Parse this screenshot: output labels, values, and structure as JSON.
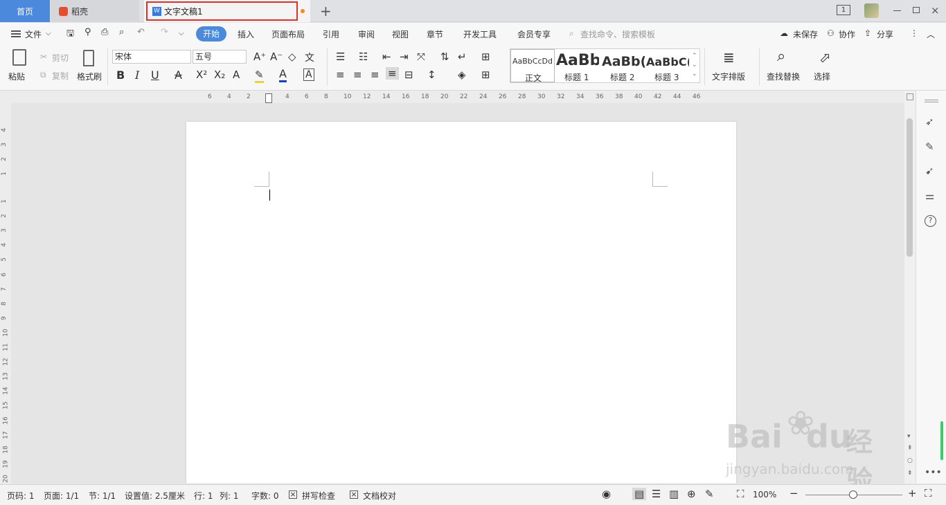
{
  "tabs": {
    "home": "首页",
    "daoke": "稻壳",
    "document": "文字文稿1"
  },
  "menubar": {
    "file": "文件",
    "items": [
      "开始",
      "插入",
      "页面布局",
      "引用",
      "审阅",
      "视图",
      "章节",
      "开发工具",
      "会员专享"
    ],
    "search_placeholder": "查找命令、搜索模板",
    "unsaved": "未保存",
    "collaborate": "协作",
    "share": "分享"
  },
  "ribbon": {
    "paste": "粘贴",
    "cut": "剪切",
    "copy": "复制",
    "format_painter": "格式刷",
    "font_name": "宋体",
    "font_size": "五号",
    "styles": [
      {
        "preview": "AaBbCcDd",
        "label": "正文"
      },
      {
        "preview": "AaBb",
        "label": "标题 1"
      },
      {
        "preview": "AaBb(",
        "label": "标题 2"
      },
      {
        "preview": "AaBbC(",
        "label": "标题 3"
      }
    ],
    "text_layout": "文字排版",
    "find_replace": "查找替换",
    "select": "选择"
  },
  "ruler": {
    "h": [
      "6",
      "4",
      "2",
      "2",
      "4",
      "6",
      "8",
      "10",
      "12",
      "14",
      "16",
      "18",
      "20",
      "22",
      "24",
      "26",
      "28",
      "30",
      "32",
      "34",
      "36",
      "38",
      "40",
      "42",
      "44",
      "46"
    ],
    "v": [
      "4",
      "3",
      "2",
      "1",
      "1",
      "2",
      "3",
      "4",
      "5",
      "6",
      "7",
      "8",
      "9",
      "10",
      "11",
      "12",
      "13",
      "14",
      "15",
      "16",
      "17",
      "18",
      "19",
      "20"
    ]
  },
  "status": {
    "page_code": "页码: 1",
    "pages": "页面: 1/1",
    "section": "节: 1/1",
    "setting": "设置值: 2.5厘米",
    "row": "行: 1",
    "col": "列: 1",
    "word_count": "字数: 0",
    "spell_check": "拼写检查",
    "doc_proof": "文档校对",
    "zoom": "100%"
  },
  "watermark": {
    "brand": "Bai",
    "brand2": "du",
    "cn": "经验",
    "url": "jingyan.baidu.com"
  },
  "colors": {
    "accent": "#4a89dc",
    "highlight_border": "#e0302a",
    "unsaved_dot": "#f08c18",
    "daoke_red": "#e4502e",
    "wps_blue": "#3b78d8"
  }
}
